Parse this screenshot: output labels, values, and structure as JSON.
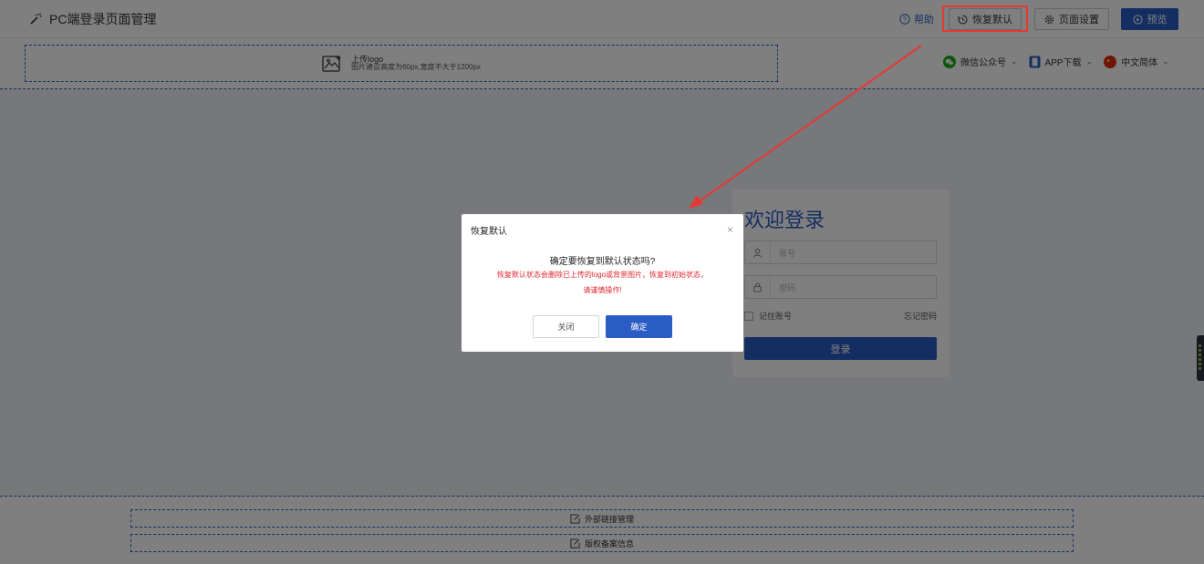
{
  "topbar": {
    "title": "PC端登录页面管理",
    "logo_icon": "magic-wand-icon",
    "help_label": "帮助",
    "restore_label": "恢复默认",
    "settings_label": "页面设置",
    "preview_label": "预览"
  },
  "header": {
    "upload_title": "上传logo",
    "upload_hint": "图片建议高度为60px,宽度不大于1200px",
    "links": [
      {
        "label": "微信公众号",
        "icon": "wechat-icon"
      },
      {
        "label": "APP下载",
        "icon": "phone-icon"
      },
      {
        "label": "中文简体",
        "icon": "china-flag-icon"
      }
    ]
  },
  "login": {
    "welcome": "欢迎登录",
    "account_placeholder": "账号",
    "password_placeholder": "密码",
    "remember_label": "记住账号",
    "forgot_label": "忘记密码",
    "login_label": "登录"
  },
  "footer": {
    "external_links_label": "外部链接管理",
    "copyright_label": "版权备案信息"
  },
  "modal": {
    "title": "恢复默认",
    "close_glyph": "×",
    "question": "确定要恢复到默认状态吗?",
    "warning_line1": "恢复默认状态会删除已上传的logo或背景图片，恢复到初始状态，",
    "warning_line2": "请谨慎操作!",
    "cancel_label": "关闭",
    "ok_label": "确定"
  },
  "colors": {
    "primary": "#2b5cc4",
    "highlight": "#e53935",
    "warning_text": "#e0262f"
  }
}
